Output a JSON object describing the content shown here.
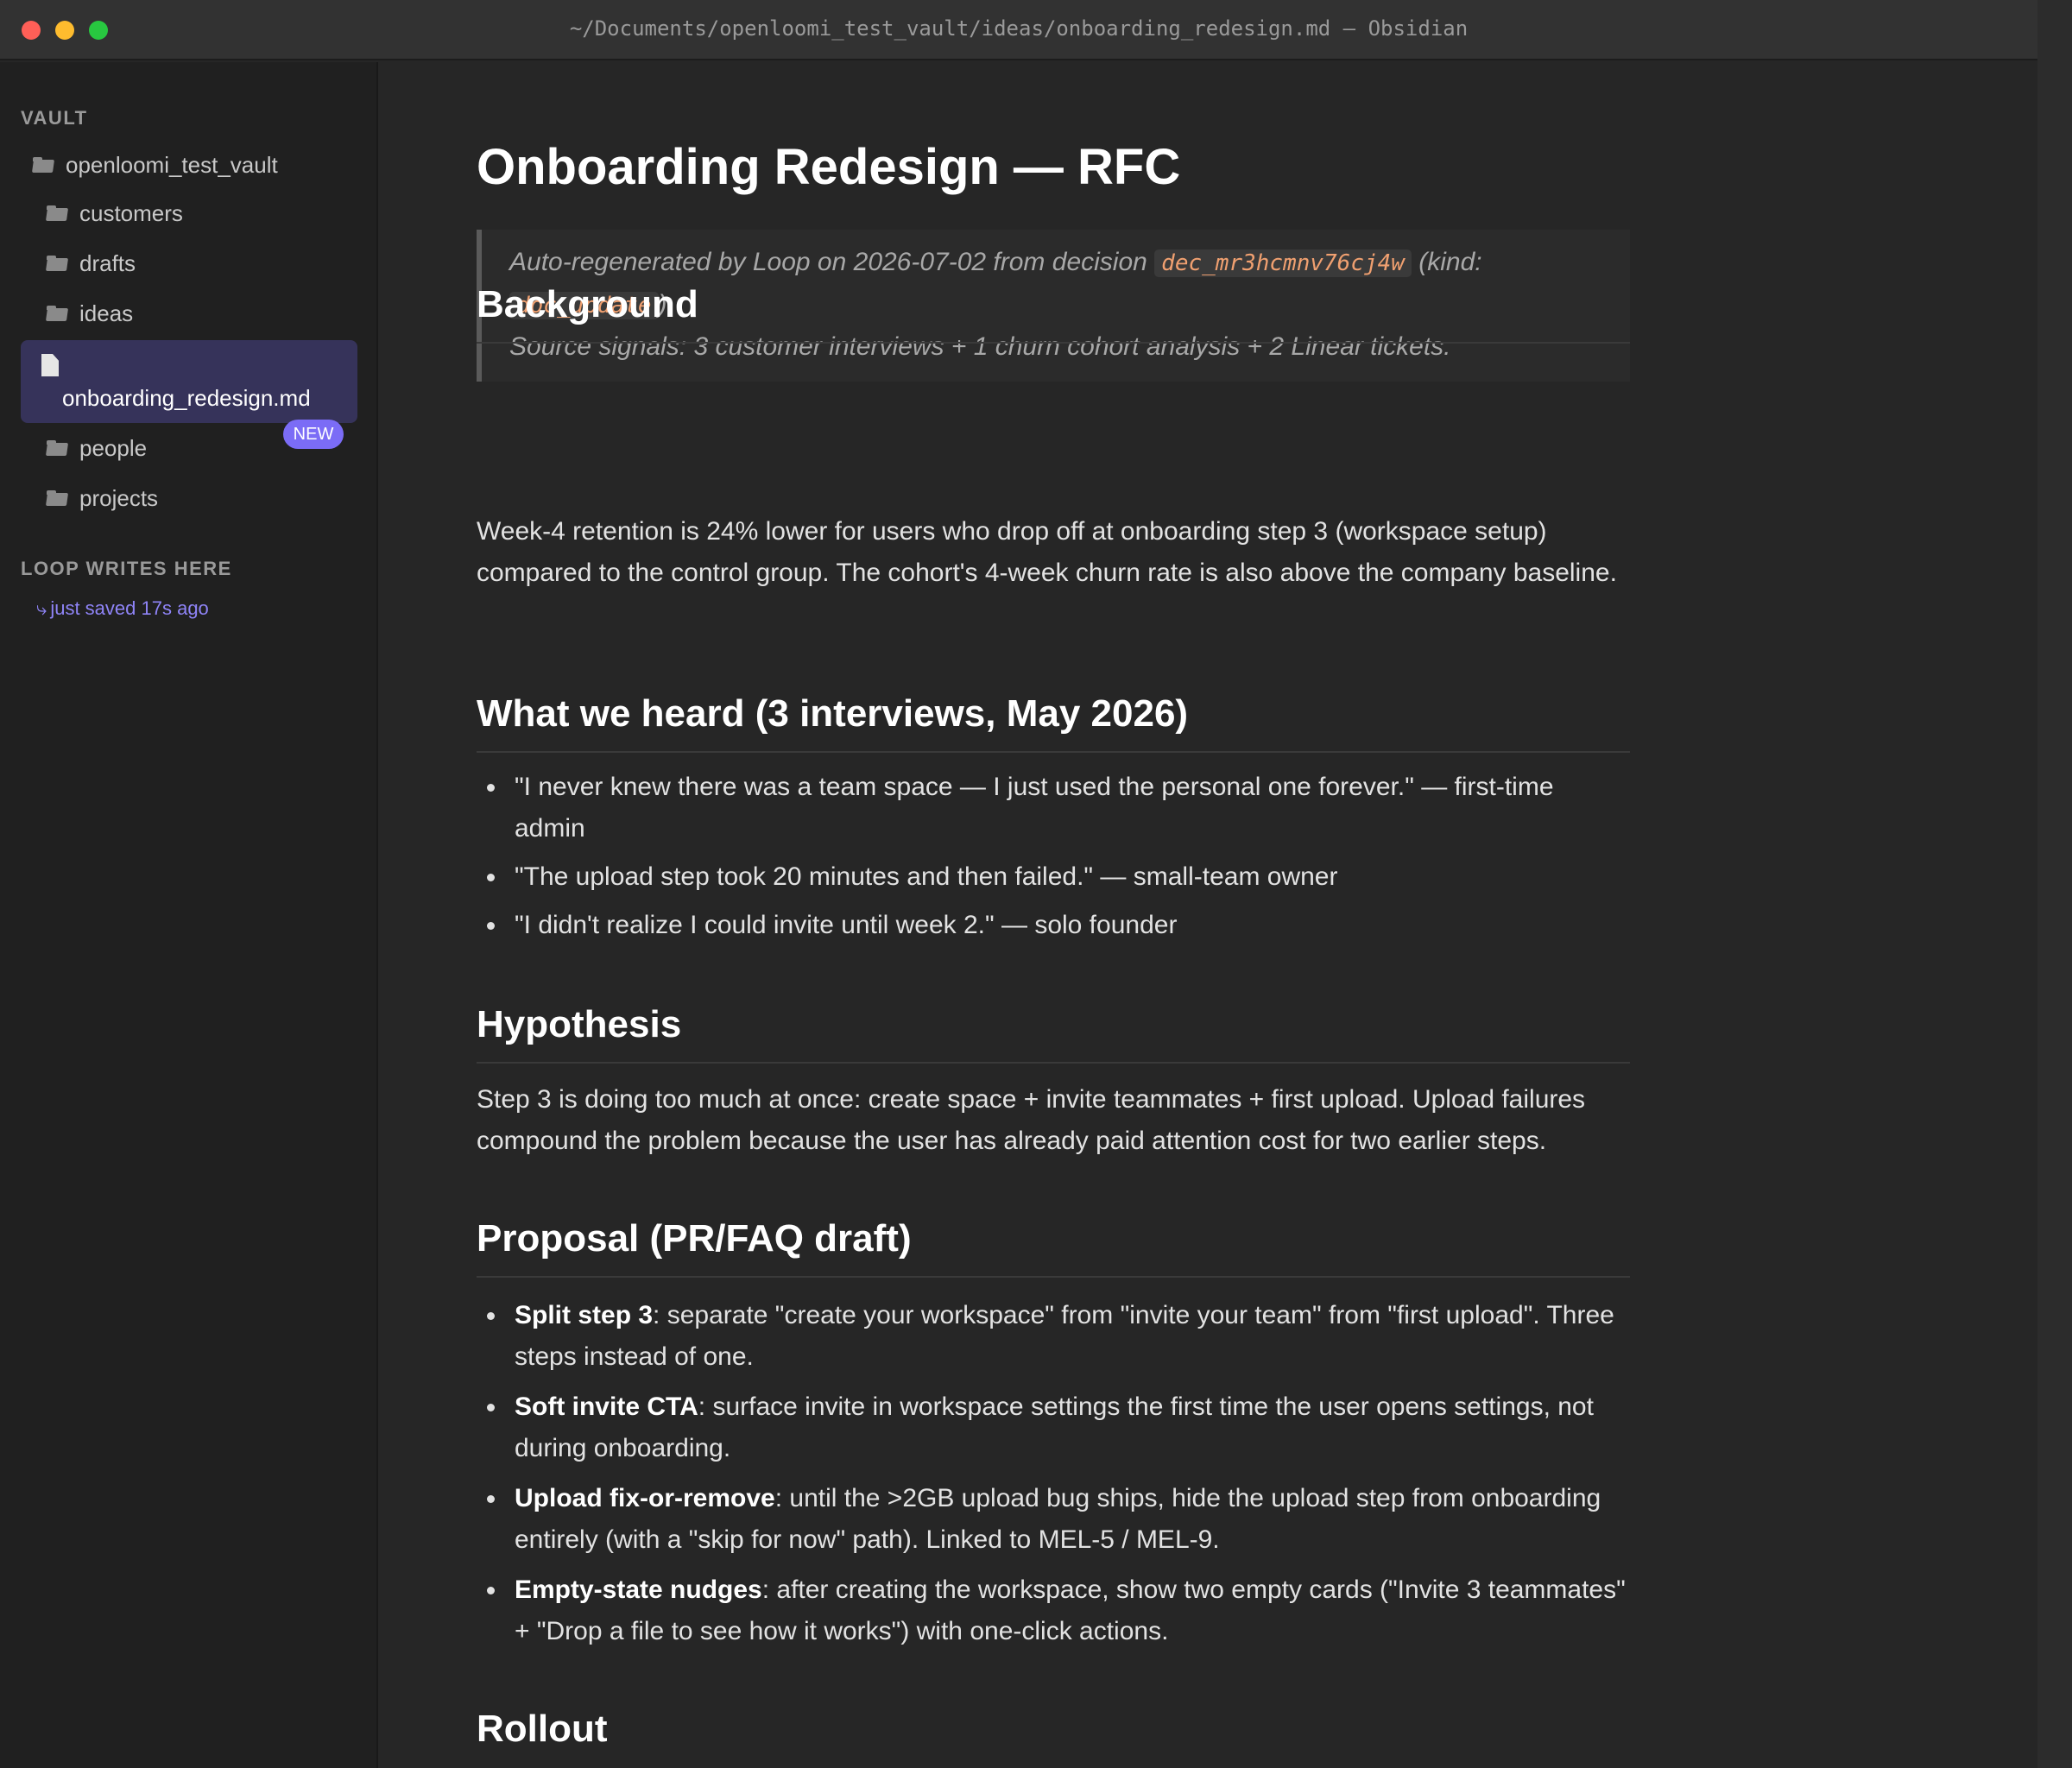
{
  "window": {
    "title": "~/Documents/openloomi_test_vault/ideas/onboarding_redesign.md — Obsidian"
  },
  "sidebar": {
    "vault_title": "VAULT",
    "root": "openloomi_test_vault",
    "folders": [
      "customers",
      "drafts",
      "ideas",
      "people",
      "projects"
    ],
    "selected_file": "onboarding_redesign.md",
    "new_badge": "NEW",
    "loop_title": "LOOP WRITES HERE",
    "loop_status": "just saved 17s ago",
    "accent_color": "#7b6cf6"
  },
  "doc": {
    "title": "Onboarding Redesign — RFC",
    "callout": {
      "prefix": "Auto-regenerated by Loop on 2026-07-02 from decision",
      "decision_id": "dec_mr3hcmnv76cj4w",
      "kind_prefix": "(kind:",
      "kind": "doc_update",
      "kind_suffix": ").",
      "signals": "Source signals: 3 customer interviews + 1 churn cohort analysis + 2 Linear tickets."
    },
    "background": {
      "heading": "Background",
      "text": "Week-4 retention is 24% lower for users who drop off at onboarding step 3 (workspace setup) compared to the control group. The cohort's 4-week churn rate is also above the company baseline."
    },
    "heard": {
      "heading": "What we heard (3 interviews, May 2026)",
      "items": [
        "\"I never knew there was a team space — I just used the personal one forever.\" — first-time admin",
        "\"The upload step took 20 minutes and then failed.\" — small-team owner",
        "\"I didn't realize I could invite until week 2.\" — solo founder"
      ]
    },
    "hypothesis": {
      "heading": "Hypothesis",
      "text": "Step 3 is doing too much at once: create space + invite teammates + first upload. Upload failures compound the problem because the user has already paid attention cost for two earlier steps."
    },
    "proposal": {
      "heading": "Proposal (PR/FAQ draft)",
      "items": [
        {
          "bold": "Split step 3",
          "text": ": separate \"create your workspace\" from \"invite your team\" from \"first upload\". Three steps instead of one."
        },
        {
          "bold": "Soft invite CTA",
          "text": ": surface invite in workspace settings the first time the user opens settings, not during onboarding."
        },
        {
          "bold": "Upload fix-or-remove",
          "text": ": until the >2GB upload bug ships, hide the upload step from onboarding entirely (with a \"skip for now\" path). Linked to MEL-5 / MEL-9."
        },
        {
          "bold": "Empty-state nudges",
          "text": ": after creating the workspace, show two empty cards (\"Invite 3 teammates\" + \"Drop a file to see how it works\") with one-click actions."
        }
      ]
    },
    "rollout": {
      "heading": "Rollout"
    }
  }
}
